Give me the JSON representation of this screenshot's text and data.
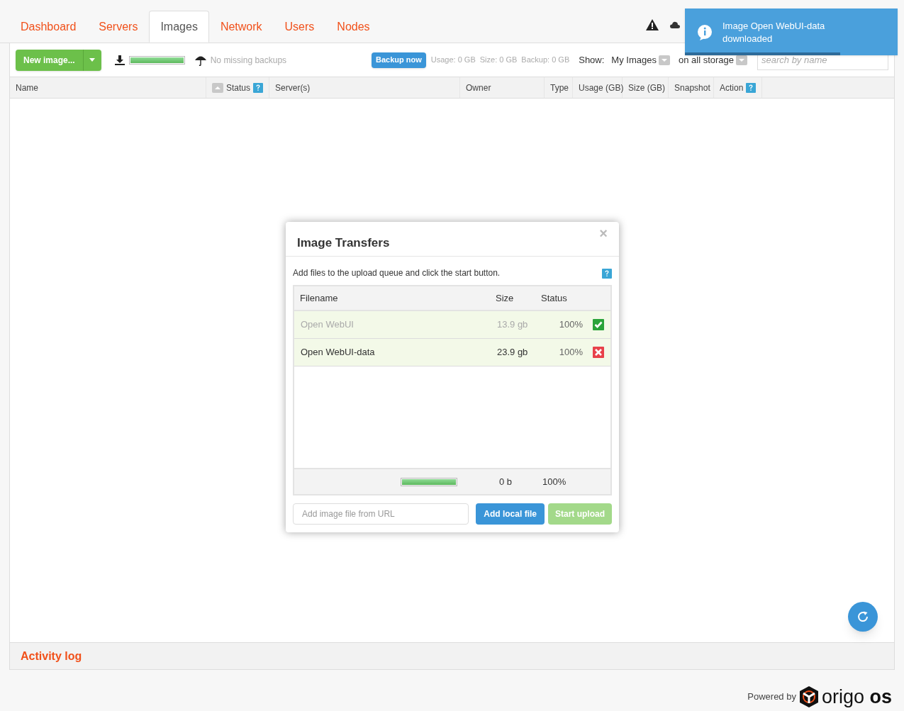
{
  "tabs": [
    {
      "label": "Dashboard",
      "selected": false
    },
    {
      "label": "Servers",
      "selected": false
    },
    {
      "label": "Images",
      "selected": true
    },
    {
      "label": "Network",
      "selected": false
    },
    {
      "label": "Users",
      "selected": false
    },
    {
      "label": "Nodes",
      "selected": false
    }
  ],
  "toast": {
    "message": "Image Open WebUI-data downloaded",
    "level": 0.73
  },
  "toolbar": {
    "new_button": "New image...",
    "download": {
      "level": 1
    },
    "backups": "No missing backups",
    "backup_button": "Backup now",
    "usage": "Usage: 0 GB",
    "size": "Size: 0 GB",
    "backup": "Backup: 0 GB",
    "show_label": "Show:",
    "filter": "My Images",
    "storage": "on all storage",
    "search": {
      "placeholder": "search by name"
    }
  },
  "columns": [
    "Name",
    "Status",
    "Server(s)",
    "Owner",
    "Type",
    "Usage (GB)",
    "Size (GB)",
    "Snapshot",
    "Action"
  ],
  "dialog": {
    "title": "Image Transfers",
    "close": "×",
    "hint": "Add files to the upload queue and click the start button.",
    "columns": [
      "Filename",
      "Size",
      "Status"
    ],
    "files": [
      {
        "name": "Open WebUI",
        "size": "13.9 gb",
        "status": "100%",
        "completed": true
      },
      {
        "name": "Open WebUI-data",
        "size": "23.9 gb",
        "status": "100%",
        "completed": false
      }
    ],
    "total": {
      "level": 1,
      "size": "0 b",
      "status": "100%"
    },
    "url_field": {
      "placeholder": "Add image file from URL"
    },
    "add_button": "Add local file",
    "start_button": "Start upload"
  },
  "activity_log": "Activity log",
  "footer": {
    "powered": "Powered by",
    "brand": "origo",
    "brand_suffix": "os"
  }
}
